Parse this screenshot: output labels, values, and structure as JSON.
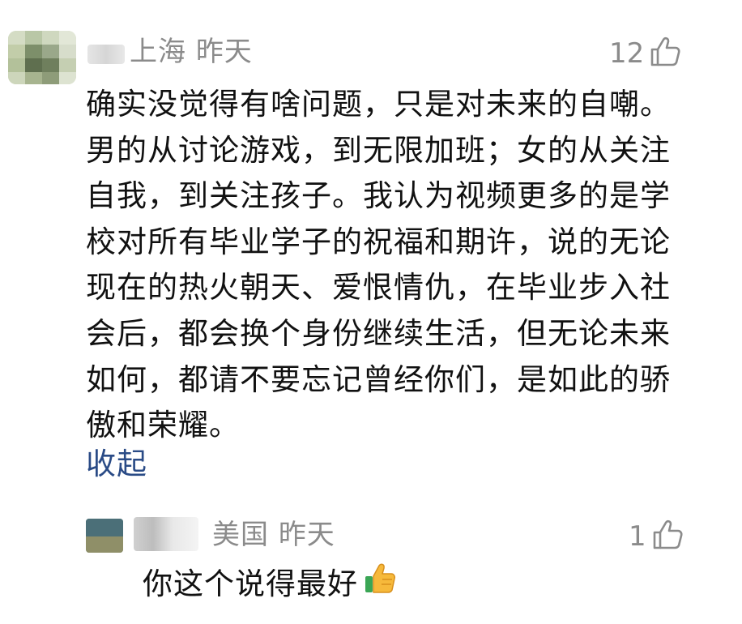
{
  "comment": {
    "location": "上海",
    "time": "昨天",
    "likes": "12",
    "text": "确实没觉得有啥问题，只是对未来的自嘲。\n男的从讨论游戏，到无限加班；女的从关注\n自我，到关注孩子。我认为视频更多的是学\n校对所有毕业学子的祝福和期许，说的无论\n现在的热火朝天、爱恨情仇，在毕业步入社\n会后，都会换个身份继续生活，但无论未来\n如何，都请不要忘记曾经你们，是如此的骄\n傲和荣耀。",
    "collapse_label": "收起",
    "like_icon": "thumbs-up-outline-icon"
  },
  "reply": {
    "location": "美国",
    "time": "昨天",
    "likes": "1",
    "text": "你这个说得最好",
    "emoji": "thumbs-up-emoji-icon"
  },
  "colors": {
    "meta_gray": "#8b8b8b",
    "link_blue": "#2a4b86",
    "emoji_yellow": "#f6b93b",
    "emoji_green": "#3aa655"
  }
}
